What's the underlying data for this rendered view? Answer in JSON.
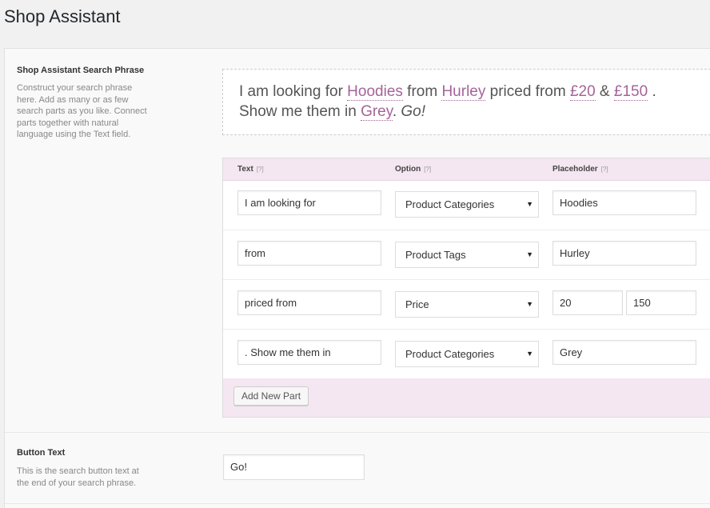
{
  "page": {
    "title": "Shop Assistant"
  },
  "search_phrase": {
    "label": "Shop Assistant Search Phrase",
    "description": "Construct your search phrase here. Add as many or as few search parts as you like. Connect parts together with natural language using the Text field.",
    "preview": {
      "t1": "I am looking for ",
      "p1": "Hoodies",
      "t2": " from ",
      "p2": "Hurley",
      "t3": " priced from ",
      "p3": "£20",
      "t4": " & ",
      "p4": "£150",
      "t5": " . Show me them in ",
      "p5": "Grey",
      "t6": ". ",
      "go": "Go!"
    }
  },
  "parts_table": {
    "headers": {
      "text": "Text",
      "option": "Option",
      "placeholder": "Placeholder",
      "help": "[?]"
    },
    "rows": [
      {
        "text": "I am looking for",
        "option": "Product Categories",
        "placeholder": "Hoodies"
      },
      {
        "text": "from",
        "option": "Product Tags",
        "placeholder": "Hurley"
      },
      {
        "text": "priced from",
        "option": "Price",
        "placeholder_min": "20",
        "placeholder_max": "150"
      },
      {
        "text": ". Show me them in",
        "option": "Product Categories",
        "placeholder": "Grey"
      }
    ],
    "add_button": "Add New Part",
    "select_arrow": "▼"
  },
  "button_text_field": {
    "label": "Button Text",
    "description": "This is the search button text at the end of your search phrase.",
    "value": "Go!"
  },
  "colors": {
    "accent": "#a46497",
    "table_header_bg": "#f4e7f1"
  }
}
